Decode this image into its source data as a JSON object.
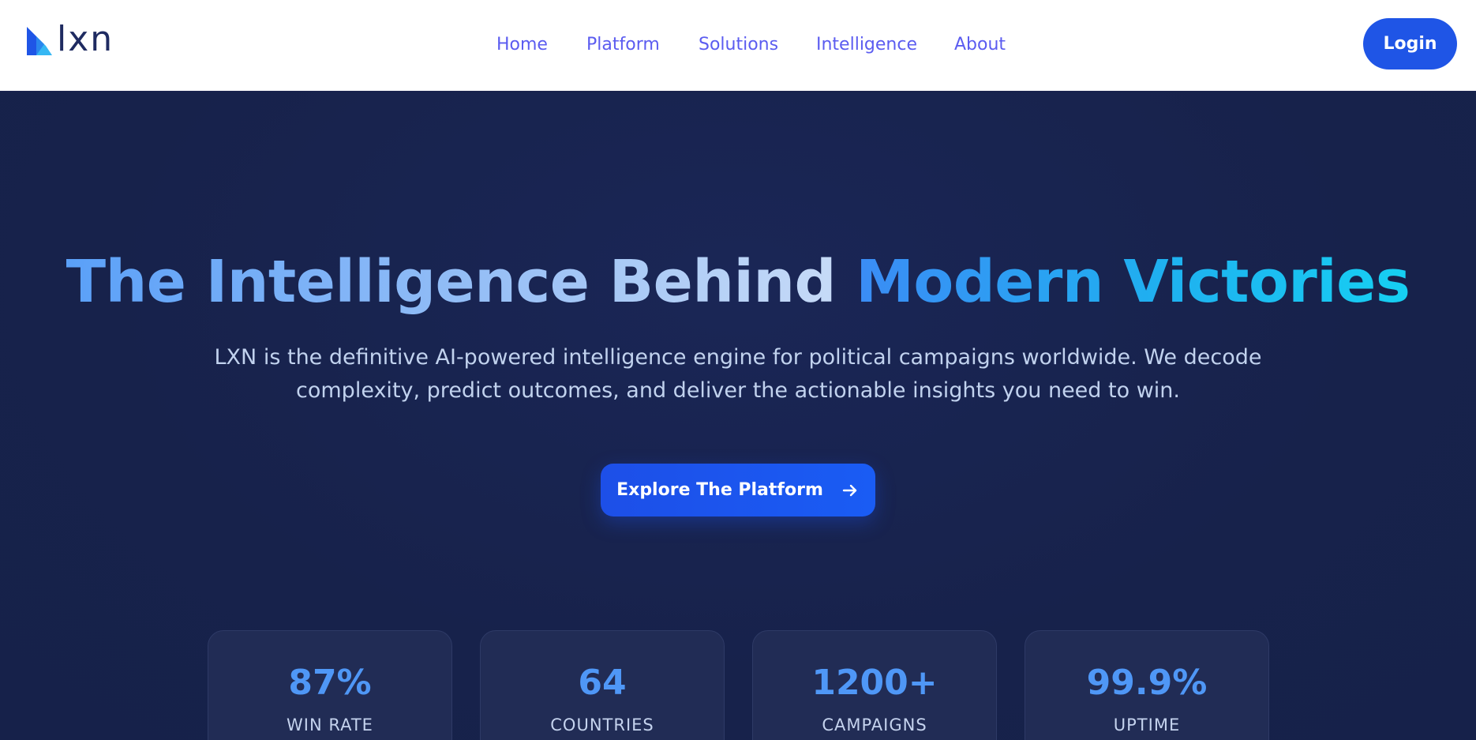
{
  "header": {
    "logo_text": "lxn",
    "nav": [
      {
        "label": "Home"
      },
      {
        "label": "Platform"
      },
      {
        "label": "Solutions"
      },
      {
        "label": "Intelligence"
      },
      {
        "label": "About"
      }
    ],
    "login_label": "Login"
  },
  "hero": {
    "title_part1": "The Intelligence Behind ",
    "title_part2": "Modern Victories",
    "subtitle": "LXN is the definitive AI-powered intelligence engine for political campaigns worldwide. We decode complexity, predict outcomes, and deliver the actionable insights you need to win.",
    "cta_label": "Explore The Platform"
  },
  "stats": [
    {
      "value": "87%",
      "label": "WIN RATE"
    },
    {
      "value": "64",
      "label": "COUNTRIES"
    },
    {
      "value": "1200+",
      "label": "CAMPAIGNS"
    },
    {
      "value": "99.9%",
      "label": "UPTIME"
    }
  ],
  "colors": {
    "background": "#17224b",
    "nav_link": "#5b5cf0",
    "primary_button": "#1f55e6",
    "stat_value": "#4f97f6",
    "title_accent": "#16d0f2"
  },
  "icons": {
    "logo": "logo-mark-icon",
    "cta_arrow": "arrow-right-icon"
  }
}
